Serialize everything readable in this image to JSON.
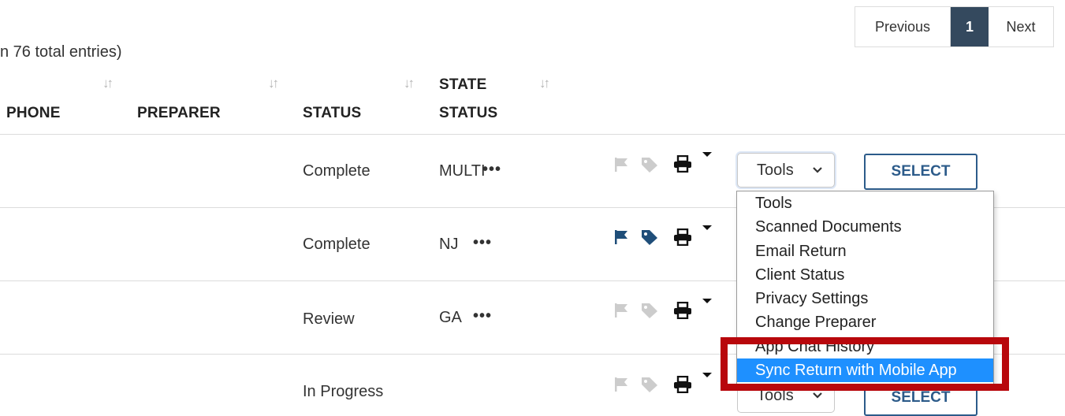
{
  "pagination": {
    "previous": "Previous",
    "current": "1",
    "next": "Next"
  },
  "entries_text": "n 76 total entries)",
  "columns": {
    "phone": "PHONE",
    "preparer": "PREPARER",
    "status": "STATUS",
    "state_status_line1": "STATE",
    "state_status_line2": "STATUS"
  },
  "sort_icon": "↓↑",
  "rows": [
    {
      "status": "Complete",
      "state": "MULTI",
      "more": "•••",
      "flag_active": false
    },
    {
      "status": "Complete",
      "state": "NJ",
      "more": "•••",
      "flag_active": true
    },
    {
      "status": "Review",
      "state": "GA",
      "more": "•••",
      "flag_active": false
    },
    {
      "status": "In Progress",
      "state": "",
      "more": "",
      "flag_active": false
    }
  ],
  "tools_select": {
    "value": "Tools",
    "partial_value": "Tools"
  },
  "select_button": "SELECT",
  "dropdown_options": [
    "Tools",
    "Scanned Documents",
    "Email Return",
    "Client Status",
    "Privacy Settings",
    "Change Preparer",
    "App Chat History",
    "Sync Return with Mobile App"
  ],
  "selected_option": "Sync Return with Mobile App",
  "colors": {
    "accent": "#2c5b8a",
    "pager_active": "#34495e",
    "flag_active": "#1f4e79",
    "icon_inactive": "#cccccc",
    "option_highlight": "#1e90ff",
    "annotation_box": "#b8070c"
  },
  "icons": [
    "sort-icon",
    "flag-icon",
    "tag-icon",
    "printer-icon",
    "caret-down-icon",
    "chevron-down-icon",
    "more-dots-icon"
  ]
}
